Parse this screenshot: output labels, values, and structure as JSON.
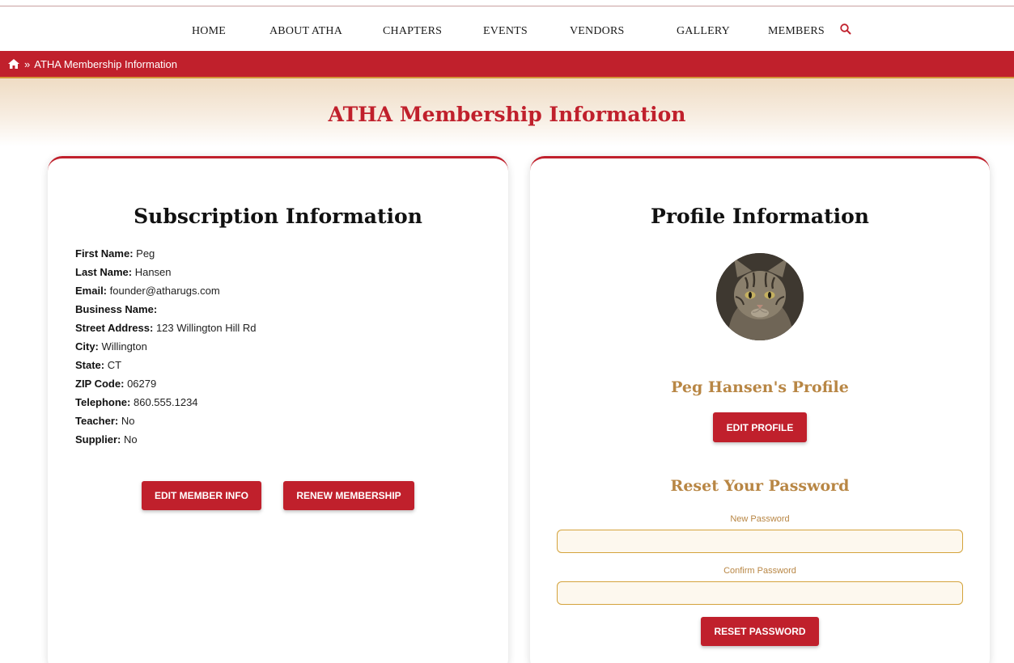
{
  "nav": {
    "items": [
      {
        "id": "home",
        "label": "HOME"
      },
      {
        "id": "about",
        "label": "ABOUT ATHA"
      },
      {
        "id": "chapters",
        "label": "CHAPTERS"
      },
      {
        "id": "events",
        "label": "EVENTS"
      },
      {
        "id": "vendors",
        "label": "VENDORS"
      },
      {
        "id": "gallery",
        "label": "GALLERY"
      },
      {
        "id": "members",
        "label": "MEMBERS"
      }
    ],
    "search_icon": "search-icon"
  },
  "breadcrumb": {
    "home_icon": "home-icon",
    "separator": "»",
    "current": "ATHA Membership Information"
  },
  "banner": {
    "title": "ATHA Membership Information"
  },
  "subscription": {
    "title": "Subscription Information",
    "fields": [
      {
        "label": "First Name:",
        "value": "Peg"
      },
      {
        "label": "Last Name:",
        "value": "Hansen"
      },
      {
        "label": "Email:",
        "value": "founder@atharugs.com"
      },
      {
        "label": "Business Name:",
        "value": ""
      },
      {
        "label": "Street Address:",
        "value": "123 Willington Hill Rd"
      },
      {
        "label": "City:",
        "value": "Willington"
      },
      {
        "label": "State:",
        "value": "CT"
      },
      {
        "label": "ZIP Code:",
        "value": "06279"
      },
      {
        "label": "Telephone:",
        "value": "860.555.1234"
      },
      {
        "label": "Teacher:",
        "value": "No"
      },
      {
        "label": "Supplier:",
        "value": "No"
      }
    ],
    "edit_button": "EDIT MEMBER INFO",
    "renew_button": "RENEW MEMBERSHIP"
  },
  "profile": {
    "title": "Profile Information",
    "avatar": "cat-avatar-image",
    "name_heading": "Peg Hansen's Profile",
    "edit_button": "EDIT PROFILE",
    "reset_title": "Reset Your Password",
    "new_password_label": "New Password",
    "new_password_value": "",
    "confirm_password_label": "Confirm Password",
    "confirm_password_value": "",
    "reset_button": "RESET PASSWORD"
  },
  "colors": {
    "brand_red": "#c0202c",
    "accent_gold": "#b88644",
    "input_border": "#d4a33c",
    "banner_tan": "#efdcc4"
  }
}
